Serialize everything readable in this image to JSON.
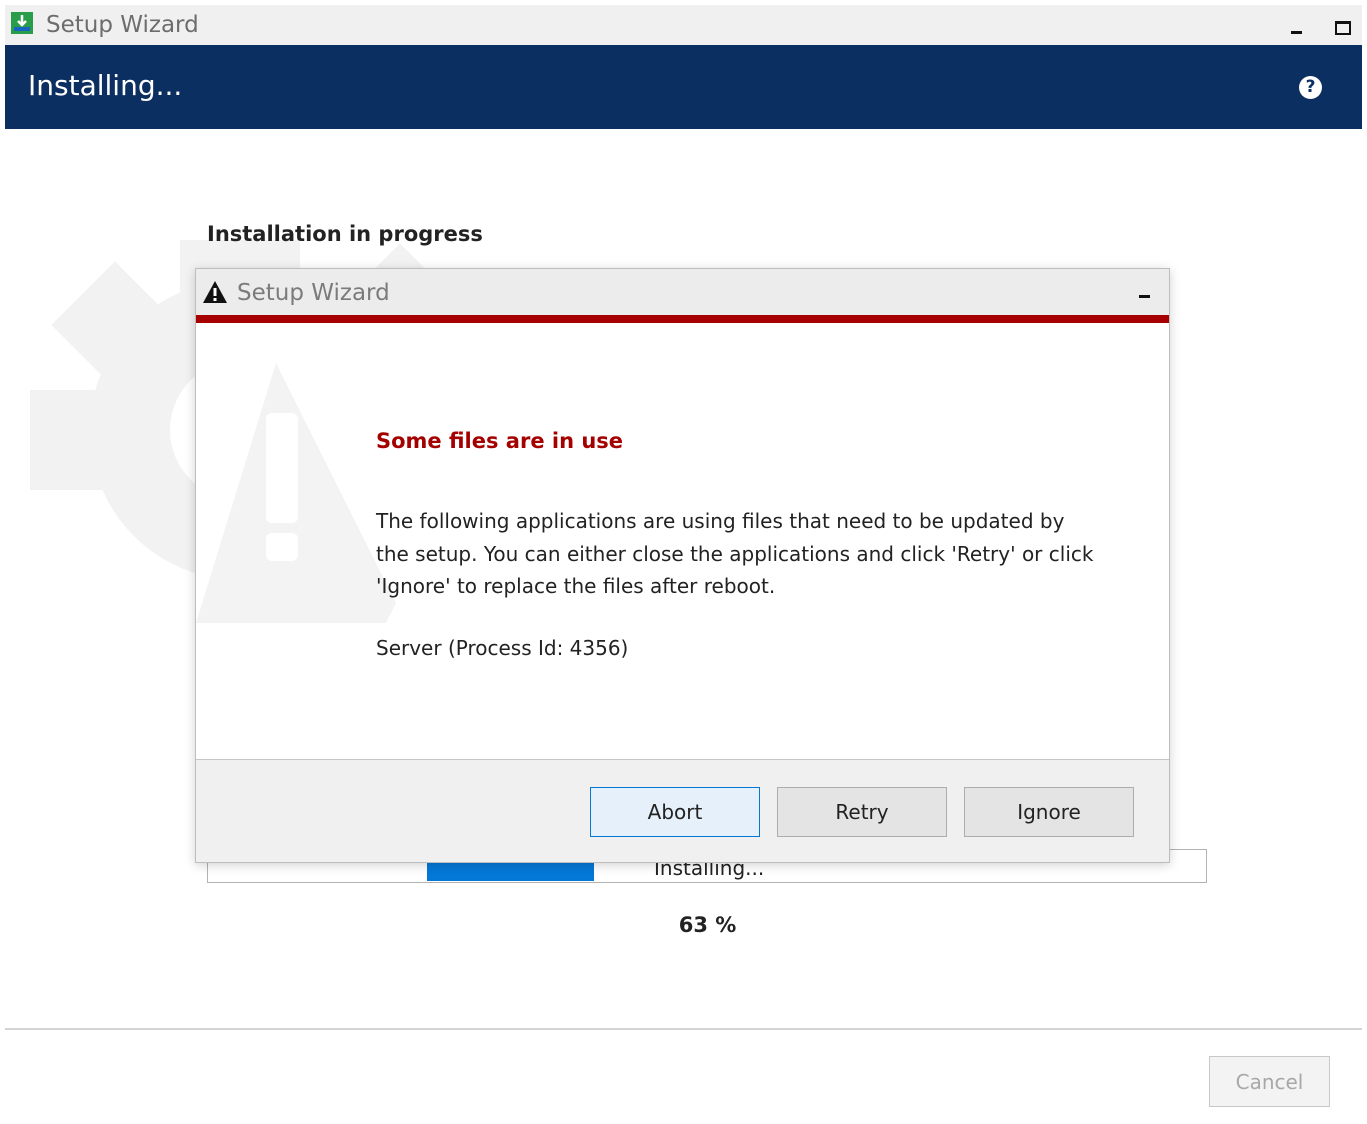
{
  "window": {
    "title": "Setup Wizard",
    "icon": "download-install-icon",
    "controls": [
      "minimize",
      "maximize"
    ]
  },
  "header": {
    "title": "Installing...",
    "help_label": "?"
  },
  "main": {
    "section_title": "Installation in progress",
    "progress": {
      "status": "Installing...",
      "percent_label": "63 %",
      "percent": 63
    }
  },
  "footer": {
    "cancel_label": "Cancel"
  },
  "dialog": {
    "title": "Setup Wizard",
    "icon": "warning-icon",
    "heading": "Some files are in use",
    "message": "The following applications are using files that need to be updated by the setup. You can either close the applications and click 'Retry' or click 'Ignore' to replace the files after reboot.",
    "process": "Server (Process Id: 4356)",
    "buttons": {
      "abort": "Abort",
      "retry": "Retry",
      "ignore": "Ignore"
    }
  },
  "colors": {
    "header_bg": "#0c2f61",
    "dialog_accent": "#a60000",
    "heading_red": "#a50000",
    "progress_fill": "#0478d7"
  }
}
